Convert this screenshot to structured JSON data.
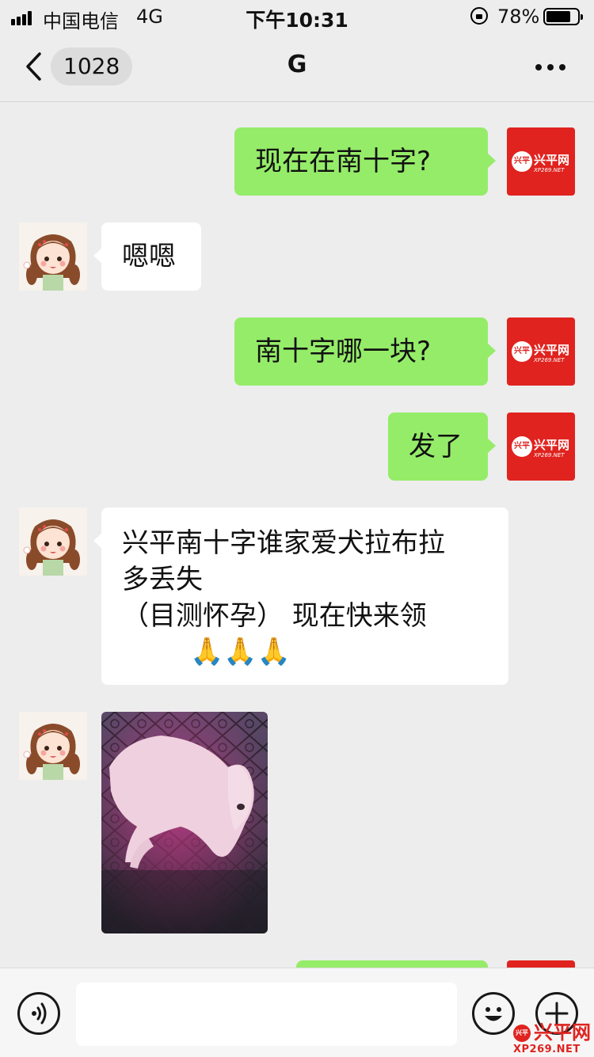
{
  "status_bar": {
    "carrier": "中国电信",
    "network": "4G",
    "time": "下午10:31",
    "battery_percent": "78%",
    "battery_level": 0.78
  },
  "nav": {
    "back_badge": "1028",
    "title": "G"
  },
  "self_avatar": {
    "badge_text": "兴平",
    "site_name": "兴平网",
    "site_url": "XP269.NET"
  },
  "messages": [
    {
      "sender": "me",
      "text": "现在在南十字?"
    },
    {
      "sender": "other",
      "text": "嗯嗯"
    },
    {
      "sender": "me",
      "text": "南十字哪一块?"
    },
    {
      "sender": "me",
      "text": "发了"
    },
    {
      "sender": "other",
      "line1": "兴平南十字谁家爱犬拉布拉",
      "line2": "多丢失",
      "line3": "（目测怀孕）   现在快来领",
      "emoji": "🙏🙏🙏"
    },
    {
      "sender": "other",
      "type": "image"
    }
  ],
  "watermark": {
    "name": "兴平网",
    "url": "XP269.NET",
    "badge_text": "兴平"
  },
  "colors": {
    "background": "#ededed",
    "self_bubble": "#95ec69",
    "other_bubble": "#ffffff",
    "brand_red": "#e0231f"
  }
}
